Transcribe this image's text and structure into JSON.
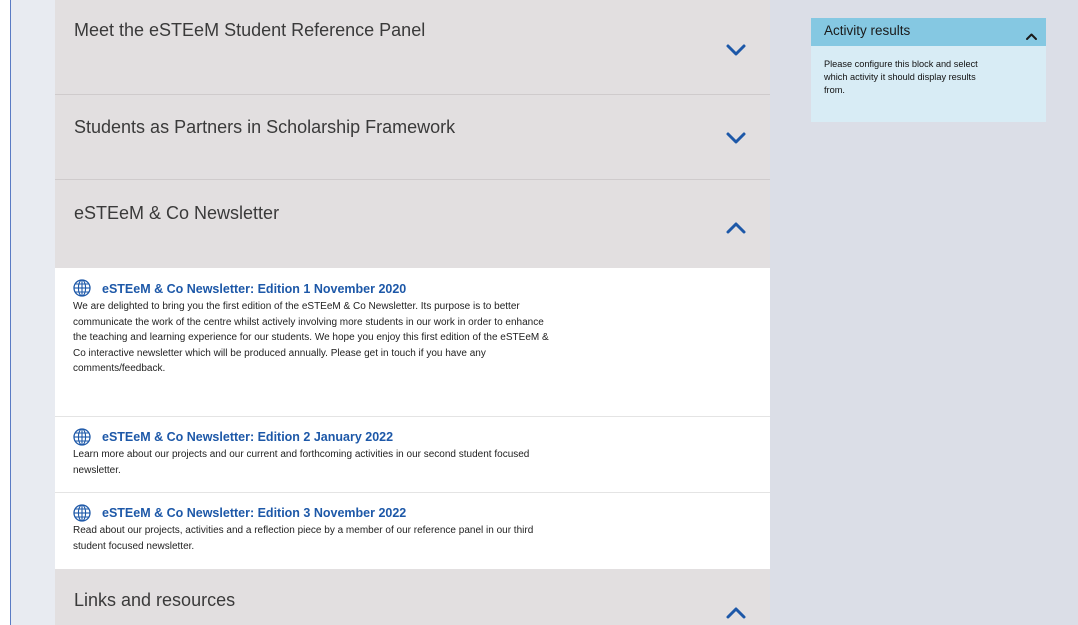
{
  "sections": [
    {
      "title": "Meet the eSTEeM Student Reference Panel",
      "state": "collapsed"
    },
    {
      "title": "Students as Partners in Scholarship Framework",
      "state": "collapsed"
    },
    {
      "title": "eSTEeM & Co Newsletter",
      "state": "expanded"
    },
    {
      "title": "Links and resources",
      "state": "expanded"
    }
  ],
  "newsletter_activities": [
    {
      "icon": "globe-icon",
      "title": "eSTEeM & Co Newsletter: Edition 1 November 2020",
      "lines": [
        "We are delighted to bring you the first edition of the eSTEeM & Co Newsletter. Its purpose is to better",
        "communicate the work of the centre whilst actively involving more students in our work in order to enhance",
        "the teaching and learning experience for our students. We hope you enjoy this first edition of the eSTEeM &",
        "Co interactive newsletter which will be produced annually. Please get in touch if you have any",
        "comments/feedback."
      ]
    },
    {
      "icon": "globe-icon",
      "title": "eSTEeM & Co Newsletter: Edition 2 January 2022",
      "lines": [
        "Learn more about our projects and our current and forthcoming activities in our second student focused",
        "newsletter."
      ]
    },
    {
      "icon": "globe-icon",
      "title": "eSTEeM & Co Newsletter: Edition 3 November 2022",
      "lines": [
        "Read about our projects, activities and a reflection piece by a member of our reference panel in our third",
        "student focused newsletter."
      ]
    }
  ],
  "activity_results_block": {
    "title": "Activity results",
    "state": "expanded",
    "lines": [
      "Please configure this block and select",
      "which activity it should display results",
      "from."
    ]
  },
  "colors": {
    "link": "#1d58a8",
    "chevron": "#1d58a8",
    "section_bg": "#e2dfe0",
    "block_header": "#85c8e2",
    "block_bg": "#d8ecf5",
    "page_bg": "#dbdee7"
  }
}
